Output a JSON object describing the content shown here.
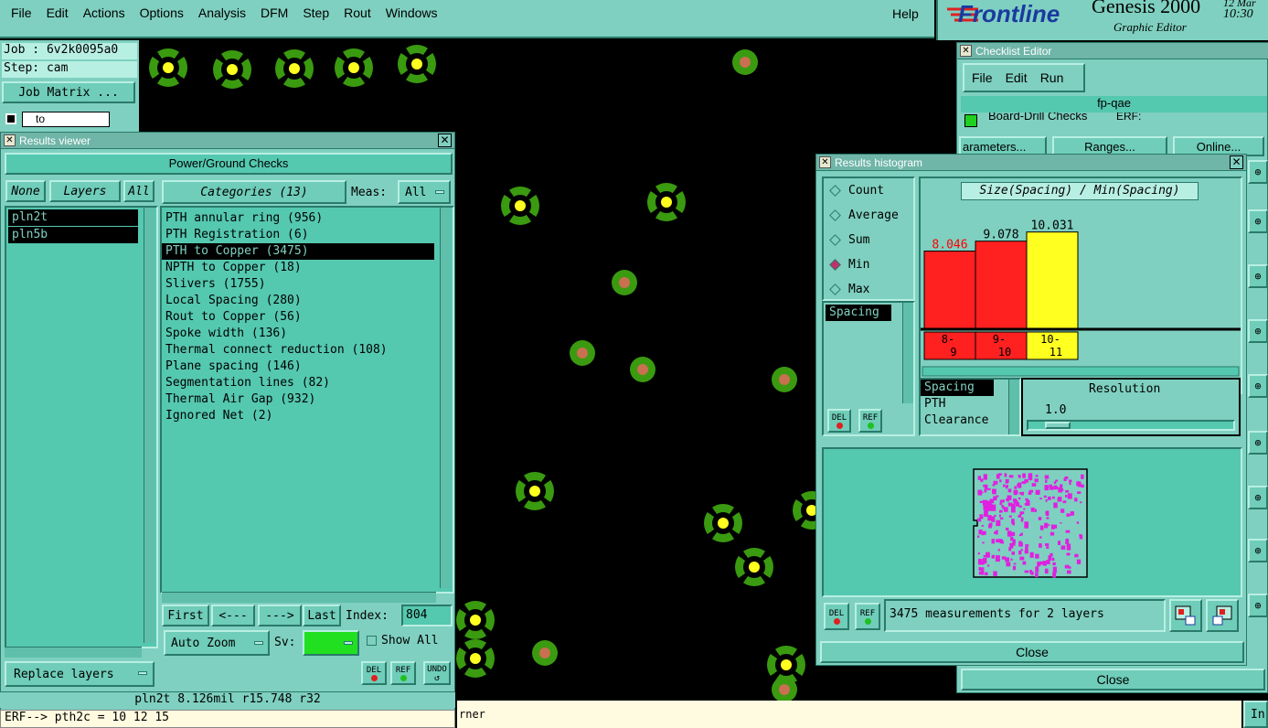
{
  "menubar": {
    "items": [
      "File",
      "Edit",
      "Actions",
      "Options",
      "Analysis",
      "DFM",
      "Step",
      "Rout",
      "Windows"
    ],
    "help": "Help"
  },
  "branding": {
    "logo": "Frontline",
    "product": "Genesis 2000",
    "subtitle": "Graphic Editor",
    "date": "12 Mar",
    "time": "10:30"
  },
  "jobinfo": {
    "job": "Job : 6v2k0095a0",
    "step": "Step: cam",
    "job_matrix": "Job Matrix ...",
    "to_field": "to"
  },
  "results_viewer": {
    "title": "Results viewer",
    "header": "Power/Ground Checks",
    "none_btn": "None",
    "layers_btn": "Layers",
    "all_btn": "All",
    "layers": [
      "pln2t",
      "pln5b"
    ],
    "categories_btn": "Categories (13)",
    "meas_label": "Meas:",
    "meas_value": "All",
    "categories": [
      "PTH annular ring (956)",
      "PTH Registration (6)",
      "PTH to Copper (3475)",
      "NPTH to Copper (18)",
      "Slivers (1755)",
      "Local Spacing (280)",
      "Rout to Copper (56)",
      "Spoke width (136)",
      "Thermal connect reduction (108)",
      "Plane spacing (146)",
      "Segmentation lines (82)",
      "Thermal Air Gap (932)",
      "Ignored Net (2)"
    ],
    "selected_index": 2,
    "first_btn": "First",
    "prev_btn": "<---",
    "next_btn": "--->",
    "last_btn": "Last",
    "index_label": "Index:",
    "index_value": "804",
    "auto_zoom": "Auto Zoom",
    "sv_label": "Sv:",
    "show_all": "Show All",
    "replace_layers": "Replace layers",
    "del": "DEL",
    "ref": "REF",
    "undo": "UNDO"
  },
  "status": {
    "line1": "pln2t 8.126mil  r15.748  r32",
    "line2": "ERF--> pth2c = 10 12 15",
    "bottom_text": "rner",
    "corner": "In"
  },
  "checklist_editor": {
    "title": "Checklist Editor",
    "menu": [
      "File",
      "Edit",
      "Run"
    ],
    "name": "fp-qae",
    "row_label": "Board-Drill Checks",
    "erf_label": "ERF:",
    "params_btn": "arameters...",
    "ranges_btn": "Ranges...",
    "online_btn": "Online...",
    "close": "Close"
  },
  "histogram": {
    "title": "Results histogram",
    "modes": [
      "Count",
      "Average",
      "Sum",
      "Min",
      "Max"
    ],
    "selected_mode": "Min",
    "measure_list": [
      "Spacing"
    ],
    "chart_title": "Size(Spacing) / Min(Spacing)",
    "del": "DEL",
    "ref": "REF",
    "param_list": [
      "Spacing",
      "PTH",
      "Clearance"
    ],
    "resolution_label": "Resolution",
    "resolution_value": "1.0",
    "summary": "3475 measurements for 2 layers",
    "close": "Close"
  },
  "chart_data": {
    "type": "bar",
    "title": "Size(Spacing) / Min(Spacing)",
    "categories": [
      "8-9",
      "9-10",
      "10-11"
    ],
    "category_labels_top": [
      "8-",
      "9-",
      "10-"
    ],
    "category_labels_bottom": [
      "9",
      "10",
      "11"
    ],
    "values": [
      8.046,
      9.078,
      10.031
    ],
    "value_labels": [
      "8.046",
      "9.078",
      "10.031"
    ],
    "colors": [
      "#ff2020",
      "#ff2020",
      "#ffff20"
    ],
    "value_label_colors": [
      "#ff0000",
      "#000000",
      "#000000"
    ],
    "ylim": [
      0,
      12
    ],
    "grid": false
  }
}
